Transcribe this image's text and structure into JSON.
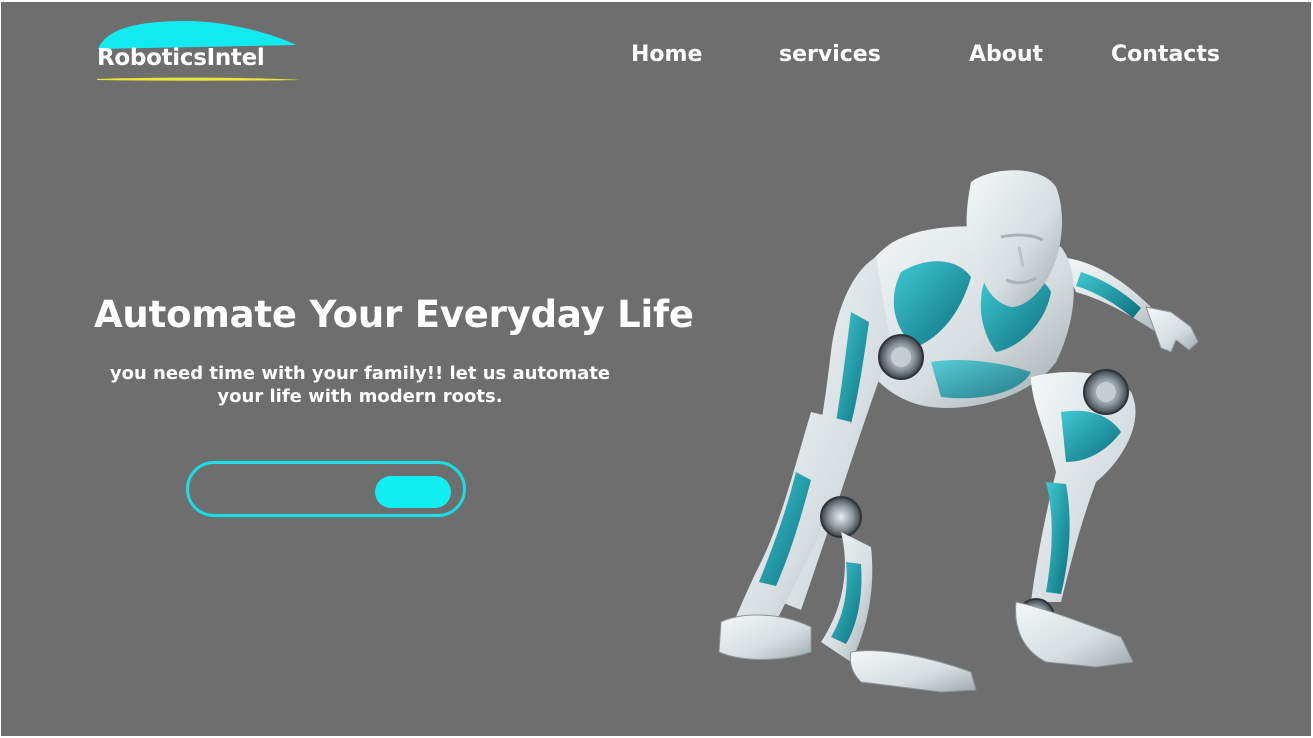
{
  "brand": {
    "name": "RoboticsIntel",
    "swoosh_color": "#13eaf0",
    "underline_color": "#e8e637"
  },
  "nav": {
    "items": [
      {
        "label": "Home"
      },
      {
        "label": "services"
      },
      {
        "label": "About"
      },
      {
        "label": "Contacts"
      }
    ]
  },
  "hero": {
    "title": "Automate Your Everyday Life",
    "subtitle": "you need time with your family!! let us automate your life with modern roots.",
    "search": {
      "value": "",
      "placeholder": ""
    },
    "button_label": ""
  },
  "colors": {
    "background": "#6e6e6e",
    "accent": "#14e0e8",
    "text": "#ffffff"
  },
  "icons": {
    "robot_image": "humanoid-robot-image"
  }
}
